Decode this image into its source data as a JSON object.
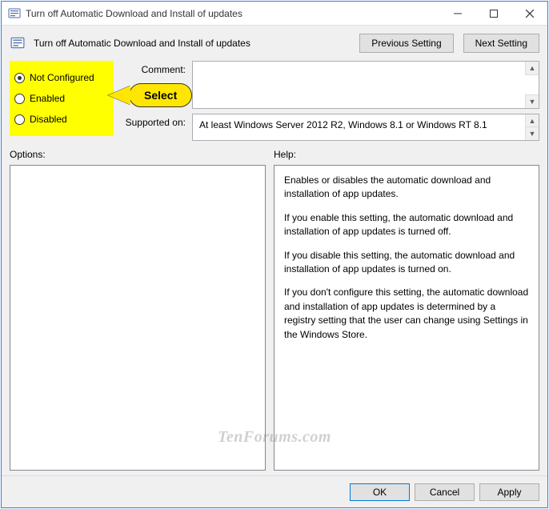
{
  "window": {
    "title": "Turn off Automatic Download and Install of updates"
  },
  "header": {
    "title": "Turn off Automatic Download and Install of updates",
    "prev_btn": "Previous Setting",
    "next_btn": "Next Setting"
  },
  "radios": {
    "not_configured": "Not Configured",
    "enabled": "Enabled",
    "disabled": "Disabled",
    "selected": "not_configured"
  },
  "callout": {
    "text": "Select"
  },
  "fields": {
    "comment_label": "Comment:",
    "comment_value": "",
    "supported_label": "Supported on:",
    "supported_value": "At least Windows Server 2012 R2, Windows 8.1 or Windows RT 8.1"
  },
  "lower": {
    "options_label": "Options:",
    "help_label": "Help:",
    "help_p1": "Enables or disables the automatic download and installation of app updates.",
    "help_p2": "If you enable this setting, the automatic download and installation of app updates is turned off.",
    "help_p3": "If you disable this setting, the automatic download and installation of app updates is turned on.",
    "help_p4": "If you don't configure this setting, the automatic download and installation of app updates is determined by a registry setting that the user can change using Settings in the Windows Store."
  },
  "footer": {
    "ok": "OK",
    "cancel": "Cancel",
    "apply": "Apply"
  },
  "watermark": "TenForums.com"
}
